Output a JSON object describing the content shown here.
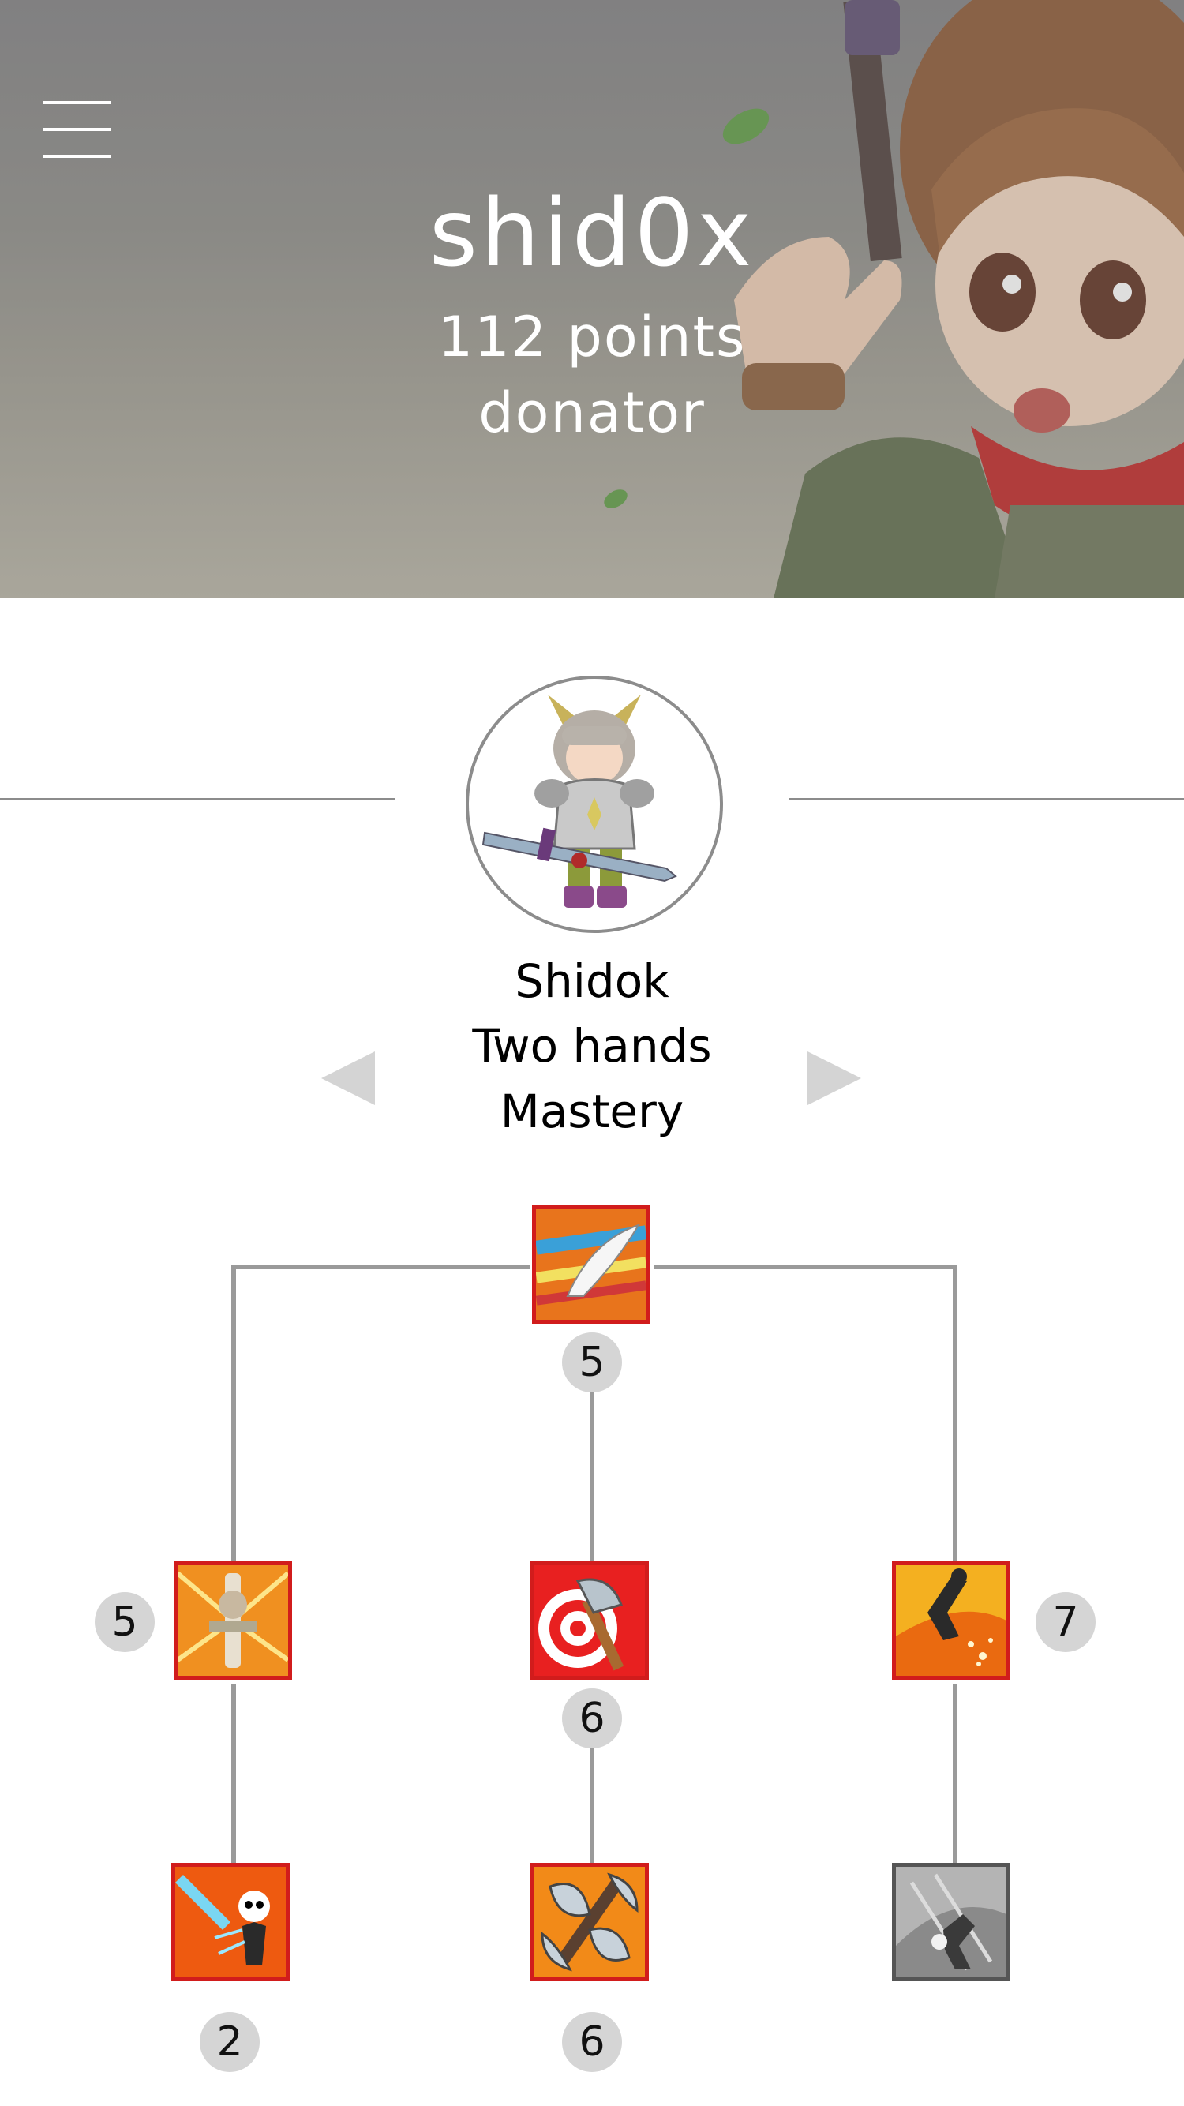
{
  "profile": {
    "username": "shid0x",
    "points": "112 points",
    "rank": "donator"
  },
  "character": {
    "name": "Shidok",
    "class": "Two hands",
    "tree": "Mastery"
  },
  "skill_tree": {
    "top": {
      "icon": "slash-skill-icon",
      "level": "5"
    },
    "mid_left": {
      "icon": "warrior-aura-skill-icon",
      "level": "5"
    },
    "mid_center": {
      "icon": "axe-target-skill-icon",
      "level": "6"
    },
    "mid_right": {
      "icon": "leap-strike-skill-icon",
      "level": "7"
    },
    "bottom_left": {
      "icon": "skull-strike-skill-icon",
      "level": "2"
    },
    "bottom_center": {
      "icon": "double-axe-skill-icon",
      "level": "6"
    },
    "bottom_right": {
      "icon": "locked-charge-skill-icon",
      "locked": true
    }
  },
  "colors": {
    "skill_border": "#d11c1c",
    "locked_border": "#555555",
    "connector": "#9a9a9a",
    "badge": "#d5d5d5"
  }
}
